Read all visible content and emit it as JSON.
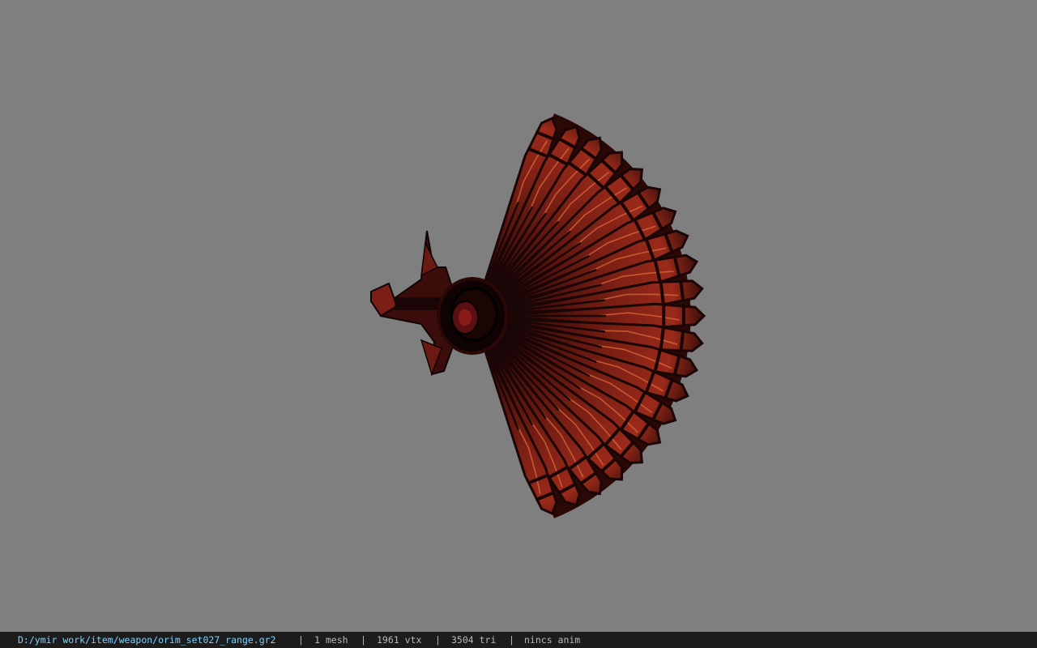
{
  "status_bar": {
    "file_path": "D:/ymir work/item/weapon/orim_set027_range.gr2",
    "separator": "|",
    "mesh_count": "1 mesh",
    "vertex_count": "1961 vtx",
    "triangle_count": "3504 tri",
    "anim_status": "nincs anim"
  },
  "colors": {
    "viewport_background": "#7f7f7f",
    "status_background": "#1c1c1c",
    "path_text": "#7fd0ff",
    "fan_dark": "#1a0606",
    "fan_red": "#8a2418",
    "fan_glow": "#e06a3c"
  },
  "model": {
    "icon": "fan-weapon-model",
    "rib_count": 21
  }
}
